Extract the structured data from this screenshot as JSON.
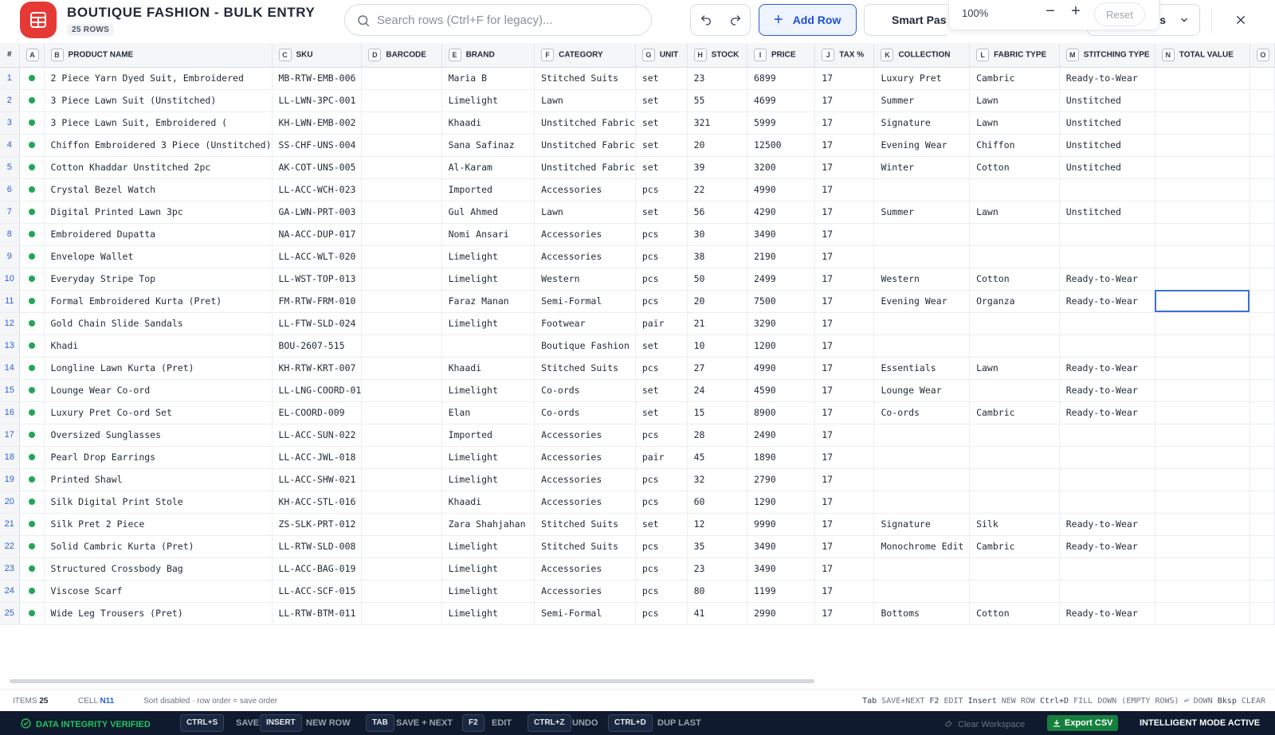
{
  "header": {
    "title": "BOUTIQUE FASHION - BULK ENTRY",
    "row_count": "25 ROWS",
    "search_placeholder": "Search rows (Ctrl+F for legacy)...",
    "add_row_label": "Add Row",
    "smart_paste_label": "Smart Paste",
    "view_dropdown_label": "s",
    "zoom": {
      "value": "100%",
      "minus": "−",
      "plus": "+",
      "reset": "Reset"
    }
  },
  "grid": {
    "columns": [
      {
        "letter": "#",
        "name": ""
      },
      {
        "letter": "A",
        "name": ""
      },
      {
        "letter": "B",
        "name": "PRODUCT NAME"
      },
      {
        "letter": "C",
        "name": "SKU"
      },
      {
        "letter": "D",
        "name": "BARCODE"
      },
      {
        "letter": "E",
        "name": "BRAND"
      },
      {
        "letter": "F",
        "name": "CATEGORY"
      },
      {
        "letter": "G",
        "name": "UNIT"
      },
      {
        "letter": "H",
        "name": "STOCK"
      },
      {
        "letter": "I",
        "name": "PRICE"
      },
      {
        "letter": "J",
        "name": "TAX %"
      },
      {
        "letter": "K",
        "name": "COLLECTION"
      },
      {
        "letter": "L",
        "name": "FABRIC TYPE"
      },
      {
        "letter": "M",
        "name": "STITCHING TYPE"
      },
      {
        "letter": "N",
        "name": "TOTAL VALUE"
      },
      {
        "letter": "O",
        "name": ""
      }
    ],
    "rows": [
      [
        "1",
        "2 Piece Yarn Dyed Suit, Embroidered",
        "MB-RTW-EMB-006",
        "",
        "Maria B",
        "Stitched Suits",
        "set",
        "23",
        "6899",
        "17",
        "Luxury Pret",
        "Cambric",
        "Ready-to-Wear",
        "",
        ""
      ],
      [
        "2",
        "3 Piece Lawn Suit (Unstitched)",
        "LL-LWN-3PC-001",
        "",
        "Limelight",
        "Lawn",
        "set",
        "55",
        "4699",
        "17",
        "Summer",
        "Lawn",
        "Unstitched",
        "",
        ""
      ],
      [
        "3",
        "3 Piece Lawn Suit, Embroidered (",
        "KH-LWN-EMB-002",
        "",
        "Khaadi",
        "Unstitched Fabric",
        "set",
        "321",
        "5999",
        "17",
        "Signature",
        "Lawn",
        "Unstitched",
        "",
        ""
      ],
      [
        "4",
        "Chiffon Embroidered 3 Piece (Unstitched)",
        "SS-CHF-UNS-004",
        "",
        "Sana Safinaz",
        "Unstitched Fabric",
        "set",
        "20",
        "12500",
        "17",
        "Evening Wear",
        "Chiffon",
        "Unstitched",
        "",
        ""
      ],
      [
        "5",
        "Cotton Khaddar Unstitched 2pc",
        "AK-COT-UNS-005",
        "",
        "Al-Karam",
        "Unstitched Fabric",
        "set",
        "39",
        "3200",
        "17",
        "Winter",
        "Cotton",
        "Unstitched",
        "",
        ""
      ],
      [
        "6",
        "Crystal Bezel Watch",
        "LL-ACC-WCH-023",
        "",
        "Imported",
        "Accessories",
        "pcs",
        "22",
        "4990",
        "17",
        "",
        "",
        "",
        "",
        ""
      ],
      [
        "7",
        "Digital Printed Lawn 3pc",
        "GA-LWN-PRT-003",
        "",
        "Gul Ahmed",
        "Lawn",
        "set",
        "56",
        "4290",
        "17",
        "Summer",
        "Lawn",
        "Unstitched",
        "",
        ""
      ],
      [
        "8",
        "Embroidered Dupatta",
        "NA-ACC-DUP-017",
        "",
        "Nomi Ansari",
        "Accessories",
        "pcs",
        "30",
        "3490",
        "17",
        "",
        "",
        "",
        "",
        ""
      ],
      [
        "9",
        "Envelope Wallet",
        "LL-ACC-WLT-020",
        "",
        "Limelight",
        "Accessories",
        "pcs",
        "38",
        "2190",
        "17",
        "",
        "",
        "",
        "",
        ""
      ],
      [
        "10",
        "Everyday Stripe Top",
        "LL-WST-TOP-013",
        "",
        "Limelight",
        "Western",
        "pcs",
        "50",
        "2499",
        "17",
        "Western",
        "Cotton",
        "Ready-to-Wear",
        "",
        ""
      ],
      [
        "11",
        "Formal Embroidered Kurta (Pret)",
        "FM-RTW-FRM-010",
        "",
        "Faraz Manan",
        "Semi-Formal",
        "pcs",
        "20",
        "7500",
        "17",
        "Evening Wear",
        "Organza",
        "Ready-to-Wear",
        "",
        ""
      ],
      [
        "12",
        "Gold Chain Slide Sandals",
        "LL-FTW-SLD-024",
        "",
        "Limelight",
        "Footwear",
        "pair",
        "21",
        "3290",
        "17",
        "",
        "",
        "",
        "",
        ""
      ],
      [
        "13",
        "Khadi",
        "BOU-2607-515",
        "",
        "",
        "Boutique Fashion",
        "set",
        "10",
        "1200",
        "17",
        "",
        "",
        "",
        "",
        ""
      ],
      [
        "14",
        "Longline Lawn Kurta (Pret)",
        "KH-RTW-KRT-007",
        "",
        "Khaadi",
        "Stitched Suits",
        "pcs",
        "27",
        "4990",
        "17",
        "Essentials",
        "Lawn",
        "Ready-to-Wear",
        "",
        ""
      ],
      [
        "15",
        "Lounge Wear Co-ord",
        "LL-LNG-COORD-01",
        "",
        "Limelight",
        "Co-ords",
        "set",
        "24",
        "4590",
        "17",
        "Lounge Wear",
        "",
        "Ready-to-Wear",
        "",
        ""
      ],
      [
        "16",
        "Luxury Pret Co-ord Set",
        "EL-COORD-009",
        "",
        "Elan",
        "Co-ords",
        "set",
        "15",
        "8900",
        "17",
        "Co-ords",
        "Cambric",
        "Ready-to-Wear",
        "",
        ""
      ],
      [
        "17",
        "Oversized Sunglasses",
        "LL-ACC-SUN-022",
        "",
        "Imported",
        "Accessories",
        "pcs",
        "28",
        "2490",
        "17",
        "",
        "",
        "",
        "",
        ""
      ],
      [
        "18",
        "Pearl Drop Earrings",
        "LL-ACC-JWL-018",
        "",
        "Limelight",
        "Accessories",
        "pair",
        "45",
        "1890",
        "17",
        "",
        "",
        "",
        "",
        ""
      ],
      [
        "19",
        "Printed Shawl",
        "LL-ACC-SHW-021",
        "",
        "Limelight",
        "Accessories",
        "pcs",
        "32",
        "2790",
        "17",
        "",
        "",
        "",
        "",
        ""
      ],
      [
        "20",
        "Silk Digital Print Stole",
        "KH-ACC-STL-016",
        "",
        "Khaadi",
        "Accessories",
        "pcs",
        "60",
        "1290",
        "17",
        "",
        "",
        "",
        "",
        ""
      ],
      [
        "21",
        "Silk Pret 2 Piece",
        "ZS-SLK-PRT-012",
        "",
        "Zara Shahjahan",
        "Stitched Suits",
        "set",
        "12",
        "9990",
        "17",
        "Signature",
        "Silk",
        "Ready-to-Wear",
        "",
        ""
      ],
      [
        "22",
        "Solid Cambric Kurta (Pret)",
        "LL-RTW-SLD-008",
        "",
        "Limelight",
        "Stitched Suits",
        "pcs",
        "35",
        "3490",
        "17",
        "Monochrome Edit",
        "Cambric",
        "Ready-to-Wear",
        "",
        ""
      ],
      [
        "23",
        "Structured Crossbody Bag",
        "LL-ACC-BAG-019",
        "",
        "Limelight",
        "Accessories",
        "pcs",
        "23",
        "3490",
        "17",
        "",
        "",
        "",
        "",
        ""
      ],
      [
        "24",
        "Viscose Scarf",
        "LL-ACC-SCF-015",
        "",
        "Limelight",
        "Accessories",
        "pcs",
        "80",
        "1199",
        "17",
        "",
        "",
        "",
        "",
        ""
      ],
      [
        "25",
        "Wide Leg Trousers (Pret)",
        "LL-RTW-BTM-011",
        "",
        "Limelight",
        "Semi-Formal",
        "pcs",
        "41",
        "2990",
        "17",
        "Bottoms",
        "Cotton",
        "Ready-to-Wear",
        "",
        ""
      ]
    ],
    "selected_row": 11,
    "selected_col": 14
  },
  "statusbar": {
    "items_label": "ITEMS",
    "items_value": "25",
    "cell_label": "CELL",
    "cell_value": "N11",
    "sort_note": "Sort disabled · row order = save order",
    "hints": [
      {
        "key": "Tab",
        "label": "SAVE+NEXT"
      },
      {
        "key": "F2",
        "label": "EDIT"
      },
      {
        "key": "Insert",
        "label": "NEW ROW"
      },
      {
        "key": "Ctrl+D",
        "label": "FILL DOWN (EMPTY ROWS)"
      },
      {
        "key": "⏎",
        "label": "DOWN"
      },
      {
        "key": "Bksp",
        "label": "CLEAR"
      }
    ]
  },
  "footer": {
    "integrity": "DATA INTEGRITY VERIFIED",
    "shortcuts": [
      {
        "key": "CTRL+S",
        "label": "SAVE"
      },
      {
        "key": "INSERT",
        "label": "NEW ROW"
      },
      {
        "key": "TAB",
        "label": "SAVE + NEXT"
      },
      {
        "key": "F2",
        "label": "EDIT"
      },
      {
        "key": "CTRL+Z",
        "label": "UNDO"
      },
      {
        "key": "CTRL+D",
        "label": "DUP LAST"
      }
    ],
    "clear_workspace": "Clear Workspace",
    "export_csv": "Export CSV",
    "intelligent_mode": "INTELLIGENT MODE ACTIVE"
  },
  "colors": {
    "accent": "#2b5fd9",
    "logo": "#e53935",
    "status_ok": "#22a654",
    "footer_bg": "#0f1a2e",
    "export_btn": "#15803d"
  }
}
